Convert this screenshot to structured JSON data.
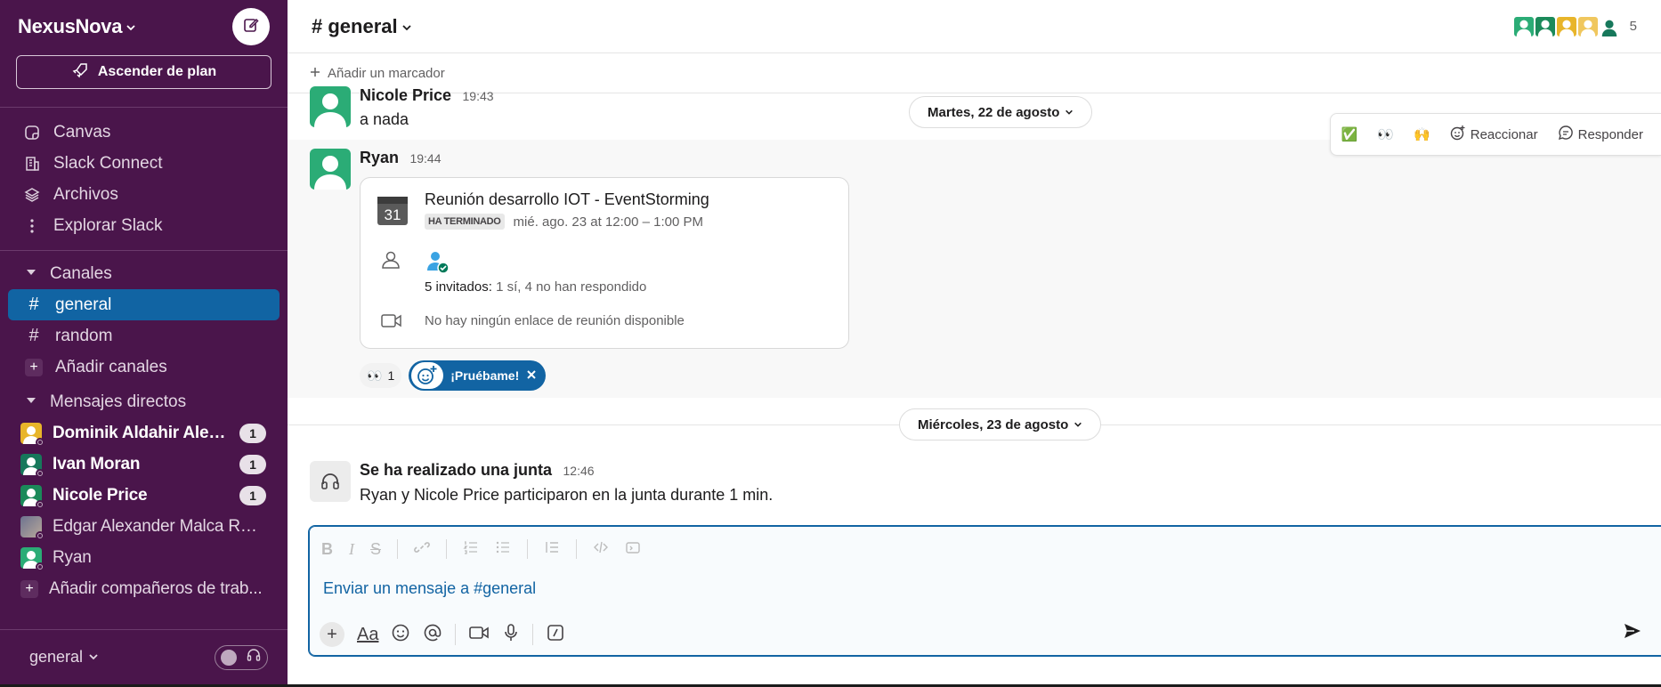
{
  "workspace": {
    "name": "NexusNova",
    "upgrade_label": "Ascender de plan"
  },
  "sidebar": {
    "nav": [
      {
        "label": "Canvas",
        "icon": "canvas-icon"
      },
      {
        "label": "Slack Connect",
        "icon": "building-icon"
      },
      {
        "label": "Archivos",
        "icon": "layers-icon"
      },
      {
        "label": "Explorar Slack",
        "icon": "more-vertical-icon"
      }
    ],
    "channels_header": "Canales",
    "channels": [
      {
        "name": "general",
        "active": true
      },
      {
        "name": "random",
        "active": false
      }
    ],
    "add_channels": "Añadir canales",
    "dms_header": "Mensajes directos",
    "dms": [
      {
        "name": "Dominik Aldahir Alexi...",
        "badge": "1",
        "color": "#e8b52a"
      },
      {
        "name": "Ivan Moran",
        "badge": "1",
        "color": "#17785b"
      },
      {
        "name": "Nicole Price",
        "badge": "1",
        "color": "#1b8a5a"
      },
      {
        "name": "Edgar Alexander Malca Roja...",
        "badge": "",
        "color": "#8a8fa8"
      },
      {
        "name": "Ryan",
        "badge": "",
        "color": "#2bac76"
      }
    ],
    "add_coworkers": "Añadir compañeros de trab...",
    "footer_channel": "general"
  },
  "header": {
    "channel": "# general",
    "member_count": "5"
  },
  "bookmark": {
    "label": "Añadir un marcador"
  },
  "messages": {
    "m1": {
      "author": "Nicole Price",
      "time": "19:43",
      "text": "a nada"
    },
    "date1": "Martes, 22 de agosto",
    "m2": {
      "author": "Ryan",
      "time": "19:44"
    },
    "event": {
      "cal_day": "31",
      "title": "Reunión desarrollo IOT - EventStorming",
      "status": "HA TERMINADO",
      "when": "mié. ago. 23 at 12:00 – 1:00 PM",
      "invitees_label": "5 invitados:",
      "invitees_detail": "1 sí, 4 no han respondido",
      "no_link": "No hay ningún enlace de reunión disponible"
    },
    "reaction": {
      "emoji": "👀",
      "count": "1"
    },
    "try_label": "¡Pruébame!",
    "hover_actions": {
      "react": "Reaccionar",
      "reply": "Responder",
      "emoji1": "✅",
      "emoji2": "👀",
      "emoji3": "🙌"
    },
    "date2": "Miércoles, 23 de agosto",
    "m3": {
      "author": "Se ha realizado una junta",
      "time": "12:46",
      "text": "Ryan y Nicole Price participaron en la junta durante 1 min."
    }
  },
  "composer": {
    "placeholder": "Enviar un mensaje a #general"
  }
}
